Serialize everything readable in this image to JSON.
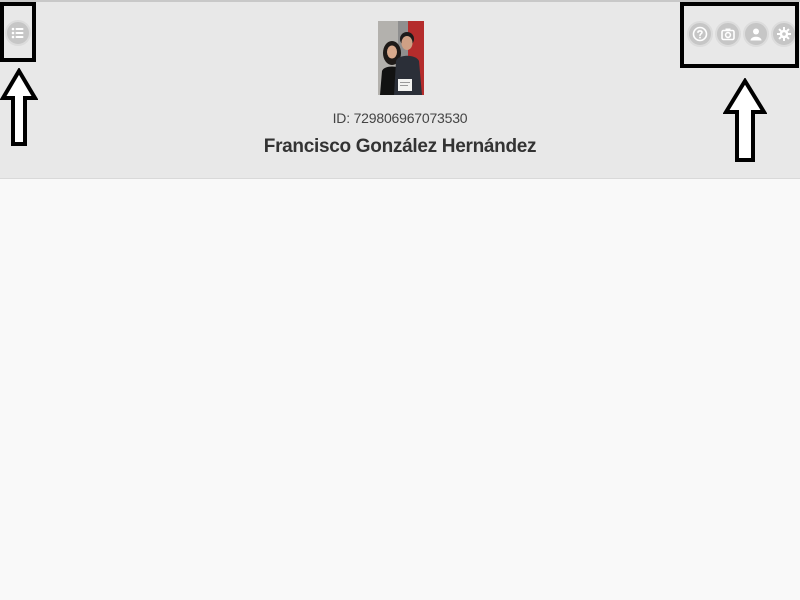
{
  "header": {
    "user_id_prefix": "ID: ",
    "user_id": "729806967073530",
    "user_name": "Francisco González Hernández"
  },
  "icons": {
    "menu": "menu-icon",
    "help": "question-icon",
    "camera": "camera-icon",
    "profile": "user-icon",
    "settings": "gear-icon"
  },
  "colors": {
    "header_bg": "#e8e8e8",
    "content_bg": "#f9f9f9",
    "icon_bg": "#c6c6c6",
    "annotation": "#000000"
  }
}
